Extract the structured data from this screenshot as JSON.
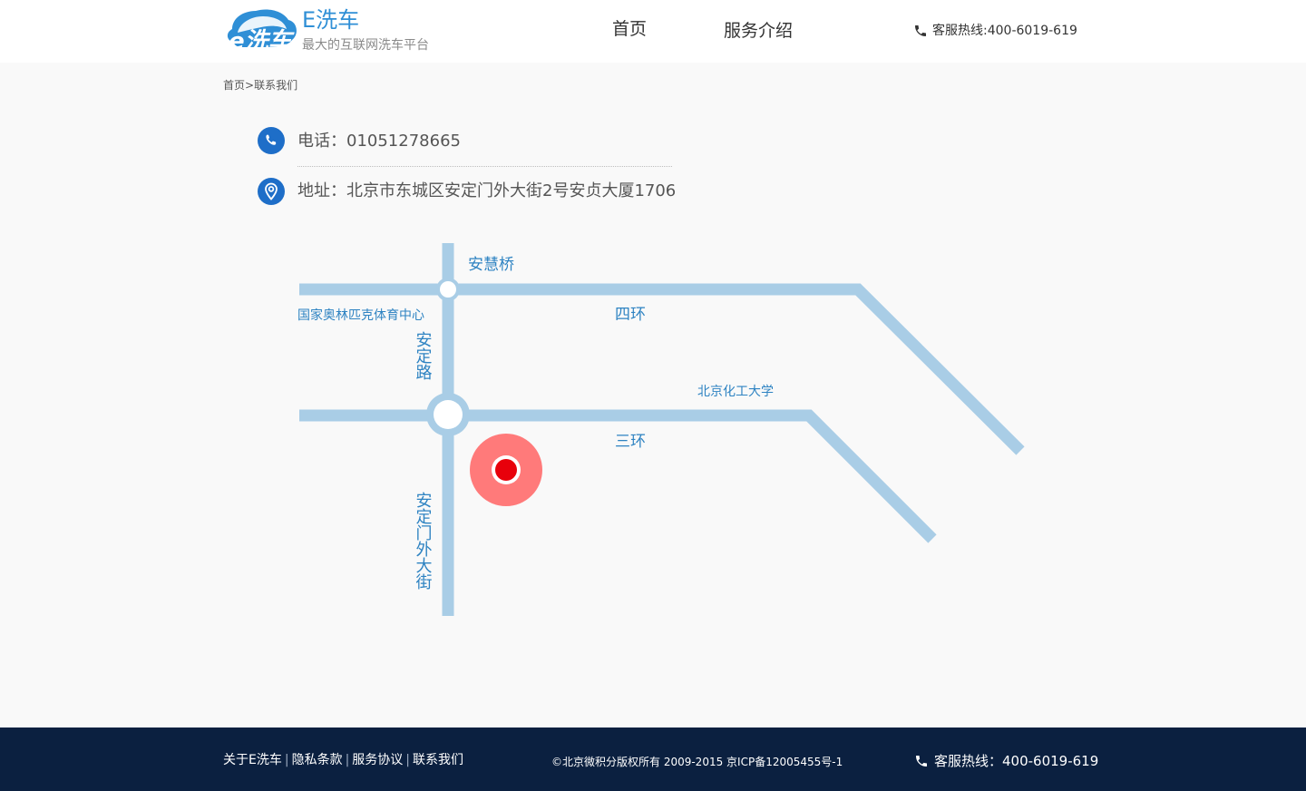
{
  "header": {
    "brand_name": "E洗车",
    "slogan": "最大的互联网洗车平台",
    "logo_text": "e洗车",
    "nav": [
      {
        "label": "首页"
      },
      {
        "label": "服务介绍"
      }
    ],
    "hotline": "客服热线:400-6019-619"
  },
  "breadcrumb": {
    "home": "首页",
    "separator": ">",
    "current": "联系我们"
  },
  "contact": {
    "phone": "电话：01051278665",
    "address": "地址：北京市东城区安定门外大街2号安贞大厦1706"
  },
  "map": {
    "labels": {
      "anhui_bridge": "安慧桥",
      "olympic_center": "国家奥林匹克体育中心",
      "fourth_ring": "四环",
      "anding_road": "安定路",
      "bucht": "北京化工大学",
      "third_ring": "三环",
      "andingmen_street": "安定门外大街"
    },
    "road_color": "#a9cde6",
    "label_color": "#2e83c2",
    "marker_color": "#ff7a7a",
    "marker_dot_color": "#e8000b"
  },
  "footer": {
    "links": [
      "关于E洗车",
      "隐私条款",
      "服务协议",
      "联系我们"
    ],
    "separator": "|",
    "copyright": "©北京微积分版权所有 2009-2015 京ICP备12005455号-1",
    "hotline": "客服热线：400-6019-619",
    "background": "#0b2040"
  },
  "colors": {
    "accent": "#2f8fd6",
    "icon_blue": "#1e6ec8"
  }
}
